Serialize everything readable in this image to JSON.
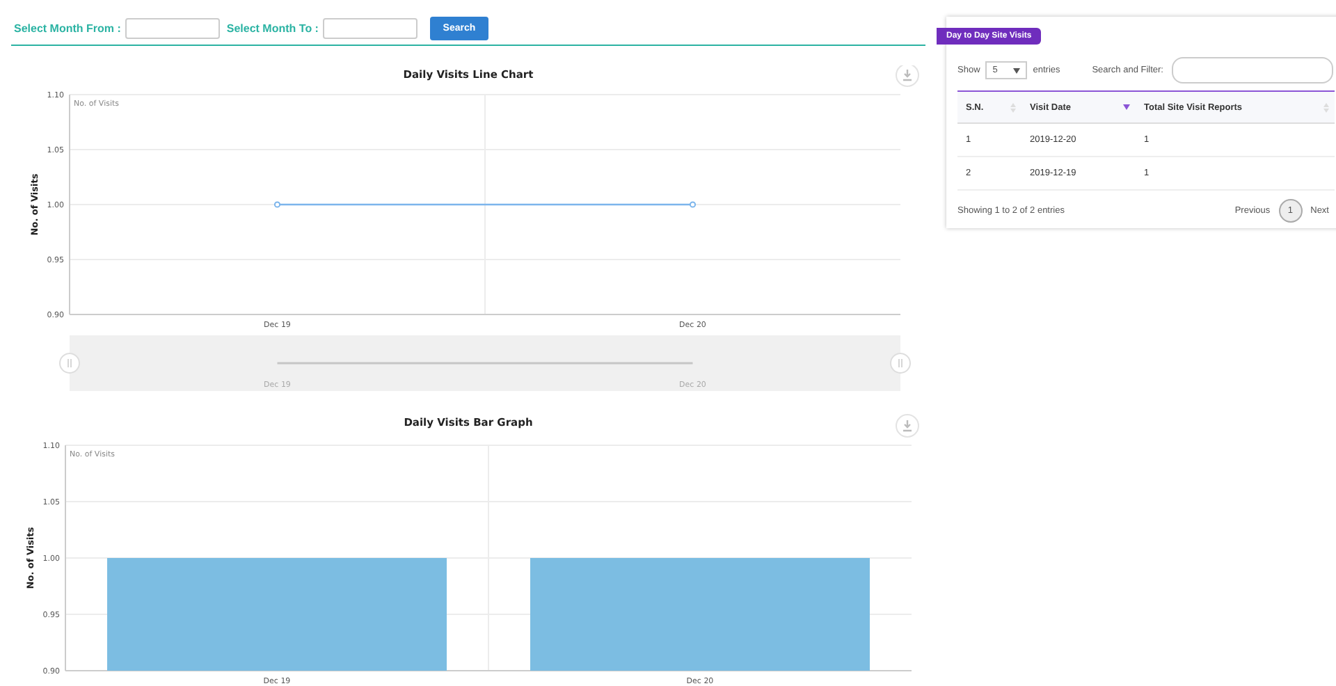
{
  "filter": {
    "from_label": "Select Month From :",
    "to_label": "Select Month To :",
    "search_button": "Search"
  },
  "line_chart": {
    "chart_data": {
      "type": "line",
      "title": "Daily Visits Line Chart",
      "ylabel": "No. of Visits",
      "categories": [
        "Dec 19",
        "Dec 20"
      ],
      "series": [
        {
          "name": "No. of Visits",
          "color": "#7cb5ec",
          "values": [
            1,
            1
          ],
          "marker": true
        }
      ],
      "grid": true,
      "ylim": [
        0.9,
        1.1
      ],
      "yticks": [
        {
          "value": 0.9,
          "label": "0.90"
        },
        {
          "value": 0.95,
          "label": "0.95"
        },
        {
          "value": 1,
          "label": "1.00"
        },
        {
          "value": 1.05,
          "label": "1.05"
        },
        {
          "value": 1.1,
          "label": "1.10"
        }
      ]
    },
    "navigator": {
      "labels": [
        "Dec 19",
        "Dec 20"
      ]
    }
  },
  "bar_chart": {
    "chart_data": {
      "type": "bar",
      "title": "Daily Visits Bar Graph",
      "ylabel": "No. of Visits",
      "categories": [
        "Dec 19",
        "Dec 20"
      ],
      "series": [
        {
          "name": "No. of Visits",
          "color": "#7cbde2",
          "values": [
            1,
            1
          ]
        }
      ],
      "grid": true,
      "ylim": [
        0.9,
        1.1
      ],
      "yticks": [
        {
          "value": 0.9,
          "label": "0.90"
        },
        {
          "value": 0.95,
          "label": "0.95"
        },
        {
          "value": 1,
          "label": "1.00"
        },
        {
          "value": 1.05,
          "label": "1.05"
        },
        {
          "value": 1.1,
          "label": "1.10"
        }
      ]
    }
  },
  "table_panel": {
    "title": "Day to Day Site Visits",
    "show_label": "Show",
    "page_size": "5",
    "entries_label": "entries",
    "search_label": "Search and Filter:",
    "columns": [
      {
        "label": "S.N.",
        "selected": false
      },
      {
        "label": "Visit Date",
        "selected": true
      },
      {
        "label": "Total Site Visit Reports",
        "selected": false
      }
    ],
    "rows": [
      [
        "1",
        "2019-12-20",
        "1"
      ],
      [
        "2",
        "2019-12-19",
        "1"
      ]
    ],
    "info": "Showing 1 to 2 of 2 entries",
    "pagination": [
      {
        "label": "Previous",
        "selected": false
      },
      {
        "label": "1",
        "selected": true
      },
      {
        "label": "Next",
        "selected": false
      }
    ]
  }
}
